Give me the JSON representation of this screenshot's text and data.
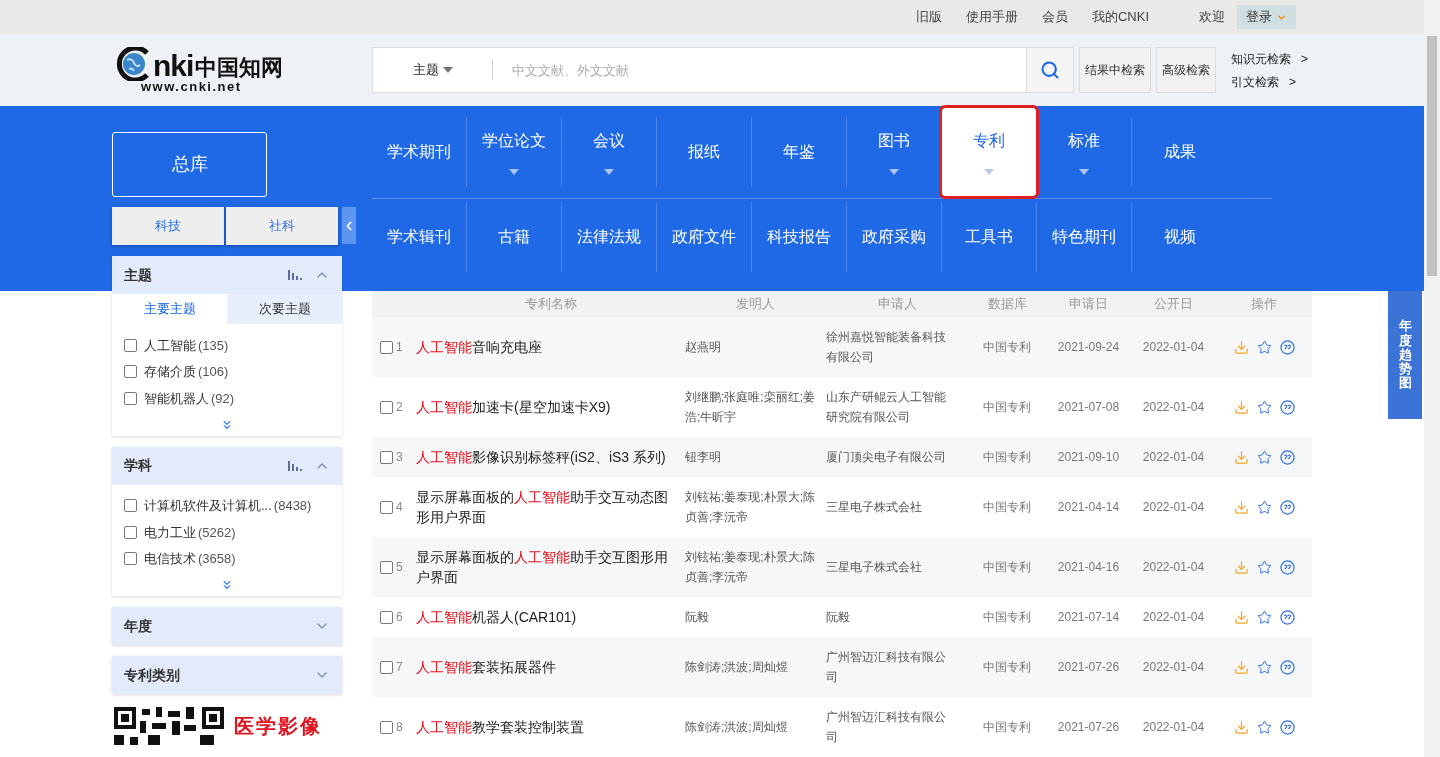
{
  "top_links": [
    "旧版",
    "使用手册",
    "会员",
    "我的CNKI"
  ],
  "welcome": "欢迎",
  "login": "登录",
  "logo": {
    "letters": "nki",
    "name": "中国知网",
    "url": "www.cnki.net"
  },
  "search": {
    "field": "主题",
    "placeholder": "中文文献、外文文献"
  },
  "search_buttons": [
    "结果中检索",
    "高级检索"
  ],
  "side_links": [
    {
      "label": "知识元检索",
      "arrow": ">"
    },
    {
      "label": "引文检索",
      "arrow": ">"
    }
  ],
  "main_db": "总库",
  "db_tabs": [
    "科技",
    "社科"
  ],
  "categories": [
    [
      {
        "label": "学术期刊",
        "has_menu": false,
        "selected": false
      },
      {
        "label": "学位论文",
        "has_menu": true,
        "selected": false
      },
      {
        "label": "会议",
        "has_menu": true,
        "selected": false
      },
      {
        "label": "报纸",
        "has_menu": false,
        "selected": false
      },
      {
        "label": "年鉴",
        "has_menu": false,
        "selected": false
      },
      {
        "label": "图书",
        "has_menu": true,
        "selected": false
      },
      {
        "label": "专利",
        "has_menu": true,
        "selected": true
      },
      {
        "label": "标准",
        "has_menu": true,
        "selected": false
      },
      {
        "label": "成果",
        "has_menu": false,
        "selected": false
      }
    ],
    [
      {
        "label": "学术辑刊",
        "has_menu": false,
        "selected": false
      },
      {
        "label": "古籍",
        "has_menu": false,
        "selected": false
      },
      {
        "label": "法律法规",
        "has_menu": false,
        "selected": false
      },
      {
        "label": "政府文件",
        "has_menu": false,
        "selected": false
      },
      {
        "label": "科技报告",
        "has_menu": false,
        "selected": false
      },
      {
        "label": "政府采购",
        "has_menu": false,
        "selected": false
      },
      {
        "label": "工具书",
        "has_menu": false,
        "selected": false
      },
      {
        "label": "特色期刊",
        "has_menu": false,
        "selected": false
      },
      {
        "label": "视频",
        "has_menu": false,
        "selected": false
      }
    ]
  ],
  "facets": [
    {
      "title": "主题",
      "expanded": true,
      "subtabs": [
        {
          "label": "主要主题",
          "selected": true
        },
        {
          "label": "次要主题",
          "selected": false
        }
      ],
      "items": [
        {
          "label": "人工智能",
          "count": "(135)",
          "checked": false
        },
        {
          "label": "存储介质",
          "count": "(106)",
          "checked": false
        },
        {
          "label": "智能机器人",
          "count": "(92)",
          "checked": false
        }
      ]
    },
    {
      "title": "学科",
      "expanded": true,
      "items": [
        {
          "label": "计算机软件及计算机...",
          "count": "(8438)",
          "checked": false
        },
        {
          "label": "电力工业",
          "count": "(5262)",
          "checked": false
        },
        {
          "label": "电信技术",
          "count": "(3658)",
          "checked": false
        }
      ]
    },
    {
      "title": "年度",
      "expanded": false
    },
    {
      "title": "专利类别",
      "expanded": false
    }
  ],
  "ad": {
    "text": "医学影像"
  },
  "table": {
    "columns": [
      "专利名称",
      "发明人",
      "申请人",
      "数据库",
      "申请日",
      "公开日",
      "操作"
    ],
    "rows": [
      {
        "number": "1",
        "checked": false,
        "title_parts": [
          {
            "text": "人工智能",
            "highlight": true
          },
          {
            "text": "音响充电座",
            "highlight": false
          }
        ],
        "inventor": "赵燕明",
        "applicant": "徐州嘉悦智能装备科技有限公司",
        "database": "中国专利",
        "application_date": "2021-09-24",
        "publication_date": "2022-01-04"
      },
      {
        "number": "2",
        "checked": false,
        "title_parts": [
          {
            "text": "人工智能",
            "highlight": true
          },
          {
            "text": "加速卡(星空加速卡X9)",
            "highlight": false
          }
        ],
        "inventor": "刘继鹏;张庭唯;栾丽红;姜浩;牛昕宇",
        "applicant": "山东产研鲲云人工智能研究院有限公司",
        "database": "中国专利",
        "application_date": "2021-07-08",
        "publication_date": "2022-01-04"
      },
      {
        "number": "3",
        "checked": false,
        "title_parts": [
          {
            "text": "人工智能",
            "highlight": true
          },
          {
            "text": "影像识别标签秤(iS2、iS3 系列)",
            "highlight": false
          }
        ],
        "inventor": "钮李明",
        "applicant": "厦门顶尖电子有限公司",
        "database": "中国专利",
        "application_date": "2021-09-10",
        "publication_date": "2022-01-04"
      },
      {
        "number": "4",
        "checked": false,
        "title_parts": [
          {
            "text": "显示屏幕面板的",
            "highlight": false
          },
          {
            "text": "人工智能",
            "highlight": true
          },
          {
            "text": "助手交互动态图形用户界面",
            "highlight": false
          }
        ],
        "inventor": "刘铉祐;姜泰现;朴景大;陈贞善;李沅帝",
        "applicant": "三星电子株式会社",
        "database": "中国专利",
        "application_date": "2021-04-14",
        "publication_date": "2022-01-04"
      },
      {
        "number": "5",
        "checked": false,
        "title_parts": [
          {
            "text": "显示屏幕面板的",
            "highlight": false
          },
          {
            "text": "人工智能",
            "highlight": true
          },
          {
            "text": "助手交互图形用户界面",
            "highlight": false
          }
        ],
        "inventor": "刘铉祐;姜泰现;朴景大;陈贞善;李沅帝",
        "applicant": "三星电子株式会社",
        "database": "中国专利",
        "application_date": "2021-04-16",
        "publication_date": "2022-01-04"
      },
      {
        "number": "6",
        "checked": false,
        "title_parts": [
          {
            "text": "人工智能",
            "highlight": true
          },
          {
            "text": "机器人(CAR101)",
            "highlight": false
          }
        ],
        "inventor": "阮毅",
        "applicant": "阮毅",
        "database": "中国专利",
        "application_date": "2021-07-14",
        "publication_date": "2022-01-04"
      },
      {
        "number": "7",
        "checked": false,
        "title_parts": [
          {
            "text": "人工智能",
            "highlight": true
          },
          {
            "text": "套装拓展器件",
            "highlight": false
          }
        ],
        "inventor": "陈剑涛;洪波;周灿煜",
        "applicant": "广州智迈汇科技有限公司",
        "database": "中国专利",
        "application_date": "2021-07-26",
        "publication_date": "2022-01-04"
      },
      {
        "number": "8",
        "checked": false,
        "title_parts": [
          {
            "text": "人工智能",
            "highlight": true
          },
          {
            "text": "教学套装控制装置",
            "highlight": false
          }
        ],
        "inventor": "陈剑涛;洪波;周灿煜",
        "applicant": "广州智迈汇科技有限公司",
        "database": "中国专利",
        "application_date": "2021-07-26",
        "publication_date": "2022-01-04"
      }
    ]
  },
  "trend_tab": "年度趋势图"
}
